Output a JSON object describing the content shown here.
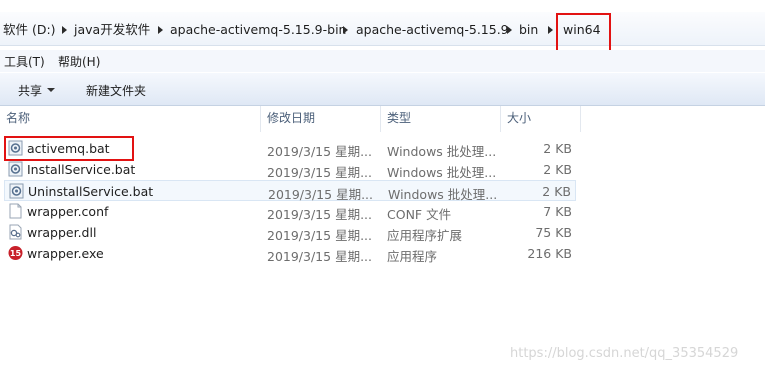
{
  "breadcrumb": {
    "items": [
      "软件 (D:)",
      "java开发软件",
      "apache-activemq-5.15.9-bin",
      "apache-activemq-5.15.9",
      "bin",
      "win64"
    ]
  },
  "menubar": {
    "tools": "工具(T)",
    "help": "帮助(H)"
  },
  "toolbar": {
    "share": "共享",
    "new_folder": "新建文件夹"
  },
  "columns": {
    "name": "名称",
    "modified": "修改日期",
    "type": "类型",
    "size": "大小"
  },
  "files": [
    {
      "name": "activemq.bat",
      "modified": "2019/3/15 星期...",
      "type": "Windows 批处理...",
      "size": "2 KB",
      "icon": "batch-file-icon"
    },
    {
      "name": "InstallService.bat",
      "modified": "2019/3/15 星期...",
      "type": "Windows 批处理...",
      "size": "2 KB",
      "icon": "batch-file-icon"
    },
    {
      "name": "UninstallService.bat",
      "modified": "2019/3/15 星期...",
      "type": "Windows 批处理...",
      "size": "2 KB",
      "icon": "batch-file-icon"
    },
    {
      "name": "wrapper.conf",
      "modified": "2019/3/15 星期...",
      "type": "CONF 文件",
      "size": "7 KB",
      "icon": "blank-file-icon"
    },
    {
      "name": "wrapper.dll",
      "modified": "2019/3/15 星期...",
      "type": "应用程序扩展",
      "size": "75 KB",
      "icon": "dll-file-icon"
    },
    {
      "name": "wrapper.exe",
      "modified": "2019/3/15 星期...",
      "type": "应用程序",
      "size": "216 KB",
      "icon": "exe-file-icon"
    }
  ],
  "watermark": "https://blog.csdn.net/qq_35354529",
  "colors": {
    "highlight_box": "#e21212",
    "hover_row": "#f3f8fd"
  }
}
